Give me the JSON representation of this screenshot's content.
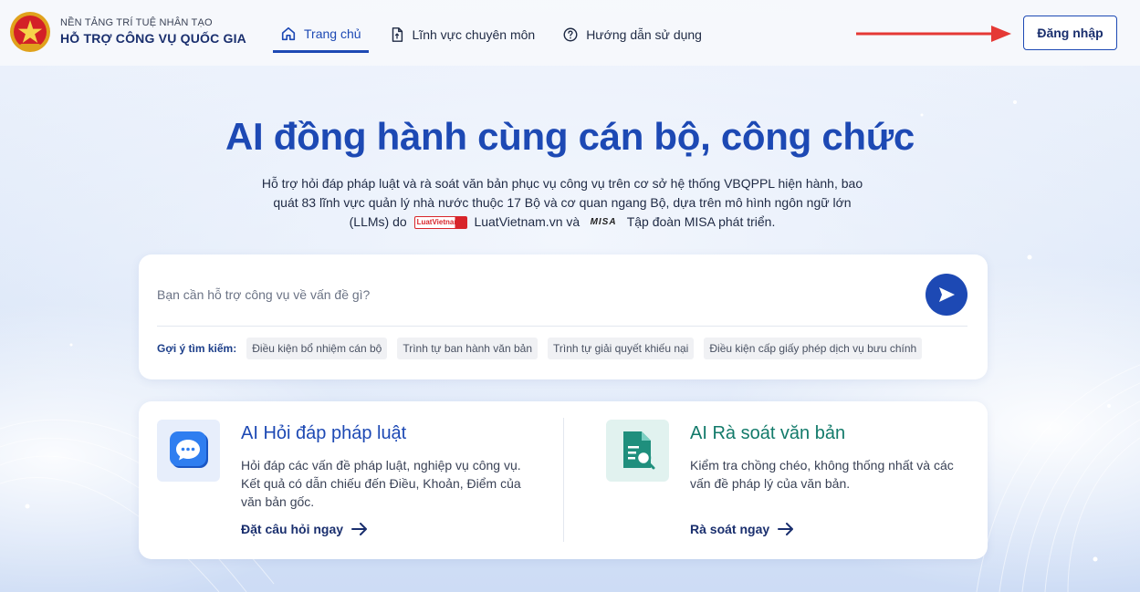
{
  "header": {
    "brand_sub": "NỀN TẢNG TRÍ TUỆ NHÂN TẠO",
    "brand_main": "HỖ TRỢ CÔNG VỤ QUỐC GIA",
    "nav": [
      {
        "label": "Trang chủ",
        "icon": "home-icon",
        "active": true
      },
      {
        "label": "Lĩnh vực chuyên môn",
        "icon": "document-icon",
        "active": false
      },
      {
        "label": "Hướng dẫn sử dụng",
        "icon": "help-circle-icon",
        "active": false
      }
    ],
    "login_label": "Đăng nhập",
    "annotation_color": "#e53935"
  },
  "hero": {
    "title": "AI đồng hành cùng cán bộ, công chức",
    "desc_line1": "Hỗ trợ hỏi đáp pháp luật và rà soát văn bản phục vụ công vụ trên cơ sở hệ thống VBQPPL hiện hành, bao",
    "desc_line2": "quát 83 lĩnh vực quản lý nhà nước thuộc 17 Bộ và cơ quan ngang Bộ, dựa trên mô hình ngôn ngữ lớn",
    "desc_line3_a": "(LLMs) do",
    "luat_logo_text": "LuatVietnam",
    "desc_line3_b": "LuatVietnam.vn và",
    "misa_logo_text": "MISA",
    "desc_line3_c": "Tập đoàn MISA phát triển."
  },
  "search": {
    "placeholder": "Bạn cần hỗ trợ công vụ về vấn đề gì?",
    "value": "",
    "suggest_label": "Gợi ý tìm kiếm:",
    "suggestions": [
      "Điều kiện bổ nhiệm cán bộ",
      "Trình tự ban hành văn bản",
      "Trình tự giải quyết khiếu nại",
      "Điều kiện cấp giấy phép dịch vụ bưu chính"
    ]
  },
  "features": [
    {
      "title": "AI Hỏi đáp pháp luật",
      "icon": "chat-bubble-icon",
      "desc": "Hỏi đáp các vấn đề pháp luật, nghiệp vụ công vụ. Kết quả có dẫn chiếu đến Điều, Khoản, Điểm của văn bản gốc.",
      "link": "Đặt câu hỏi ngay"
    },
    {
      "title": "AI Rà soát văn bản",
      "icon": "document-search-icon",
      "desc": "Kiểm tra chồng chéo, không thống nhất và các vấn đề pháp lý của văn bản.",
      "link": "Rà soát ngay"
    }
  ],
  "colors": {
    "primary": "#1d49b4",
    "teal": "#127a6a",
    "navy": "#1a2f6e"
  }
}
